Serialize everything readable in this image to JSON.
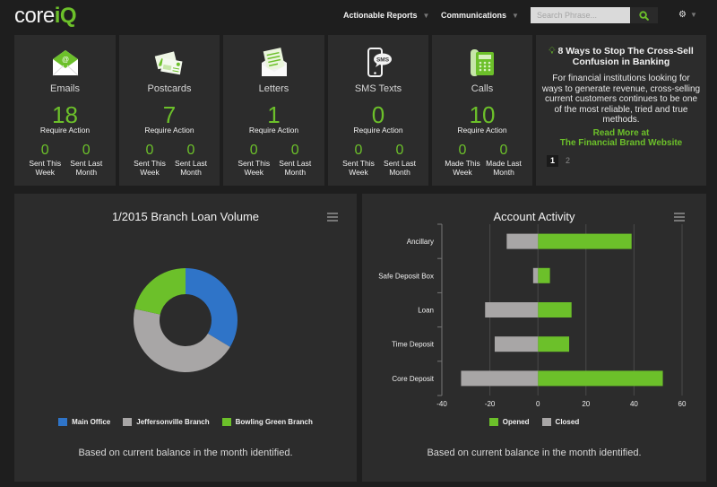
{
  "header": {
    "logo_core": "core",
    "logo_iq": "iQ",
    "nav": [
      {
        "label": "Actionable Reports",
        "icon": "caret-down-icon"
      },
      {
        "label": "Communications",
        "icon": "caret-down-icon"
      }
    ],
    "search": {
      "placeholder": "Search Phrase...",
      "value": "",
      "button_icon": "search-icon"
    },
    "settings_icon": "gear-icon"
  },
  "colors": {
    "accent": "#6cc02a",
    "blue": "#2f74c8",
    "gray": "#a8a6a6",
    "panel": "#2c2c2c",
    "background": "#1e1e1e"
  },
  "cards": [
    {
      "label": "Emails",
      "icon": "email-envelope-icon",
      "count": "18",
      "count_label": "Require Action",
      "sub": [
        {
          "value": "0",
          "label": "Sent This Week"
        },
        {
          "value": "0",
          "label": "Sent Last Month"
        }
      ]
    },
    {
      "label": "Postcards",
      "icon": "postcards-icon",
      "count": "7",
      "count_label": "Require Action",
      "sub": [
        {
          "value": "0",
          "label": "Sent This Week"
        },
        {
          "value": "0",
          "label": "Sent Last Month"
        }
      ]
    },
    {
      "label": "Letters",
      "icon": "letter-icon",
      "count": "1",
      "count_label": "Require Action",
      "sub": [
        {
          "value": "0",
          "label": "Sent This Week"
        },
        {
          "value": "0",
          "label": "Sent Last Month"
        }
      ]
    },
    {
      "label": "SMS Texts",
      "icon": "sms-phone-icon",
      "count": "0",
      "count_label": "Require Action",
      "sub": [
        {
          "value": "0",
          "label": "Sent This Week"
        },
        {
          "value": "0",
          "label": "Sent Last Month"
        }
      ]
    },
    {
      "label": "Calls",
      "icon": "telephone-icon",
      "count": "10",
      "count_label": "Require Action",
      "sub": [
        {
          "value": "0",
          "label": "Made This Week"
        },
        {
          "value": "0",
          "label": "Made Last Month"
        }
      ]
    }
  ],
  "article": {
    "icon": "lightbulb-icon",
    "title": "8 Ways to Stop The Cross-Sell Confusion in Banking",
    "body": "For financial institutions looking for ways to generate revenue, cross-selling current customers continues to be one of the most reliable, tried and true methods.",
    "link_line1": "Read More at",
    "link_line2": "The Financial Brand Website",
    "pages": [
      "1",
      "2"
    ],
    "active_page": "1"
  },
  "chart_data": [
    {
      "type": "pie",
      "variant": "donut",
      "title": "1/2015 Branch Loan Volume",
      "categories": [
        "Main Office",
        "Jeffersonville Branch",
        "Bowling Green Branch"
      ],
      "values": [
        33.6,
        44.9,
        21.5
      ],
      "unit": "percent (estimated)",
      "colors": [
        "#2f74c8",
        "#a8a6a6",
        "#6cc02a"
      ],
      "legend": "bottom",
      "footnote": "Based on current balance in the month identified.",
      "menu_icon": "hamburger-menu-icon"
    },
    {
      "type": "bar",
      "orientation": "horizontal",
      "stacked": true,
      "title": "Account Activity",
      "categories": [
        "Ancillary",
        "Safe Deposit Box",
        "Loan",
        "Time Deposit",
        "Core Deposit"
      ],
      "series": [
        {
          "name": "Opened",
          "color": "#6cc02a",
          "values": [
            39,
            5,
            14,
            13,
            52
          ]
        },
        {
          "name": "Closed",
          "color": "#a8a6a6",
          "values": [
            -13,
            -2,
            -22,
            -18,
            -32
          ]
        }
      ],
      "xlim": [
        -40,
        60
      ],
      "xticks": [
        "-40",
        "-20",
        "0",
        "20",
        "40",
        "60"
      ],
      "grid": true,
      "legend": "bottom",
      "footnote": "Based on current balance in the month identified.",
      "menu_icon": "hamburger-menu-icon"
    }
  ]
}
